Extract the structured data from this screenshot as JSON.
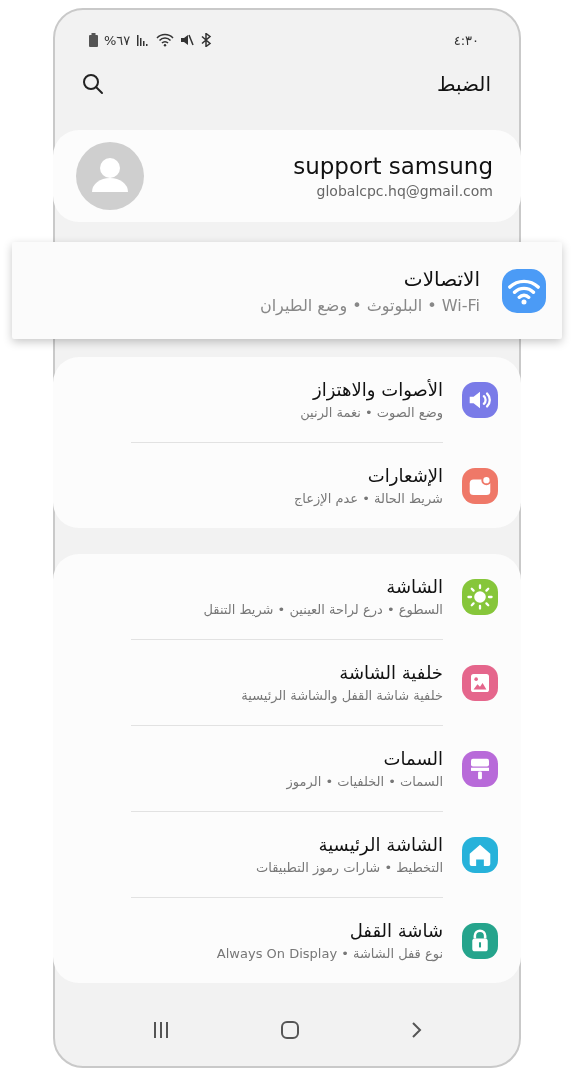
{
  "status_bar": {
    "time": "٤:٣٠",
    "battery": "%٦٧"
  },
  "header": {
    "title": "الضبط"
  },
  "profile": {
    "name": "support samsung",
    "email": "globalcpc.hq@gmail.com"
  },
  "groups": [
    {
      "highlighted": true,
      "items": [
        {
          "title": "الاتصالات",
          "subtitle": "Wi-Fi • البلوتوث • وضع الطيران",
          "color": "#4b9bf6"
        }
      ]
    },
    {
      "highlighted": false,
      "items": [
        {
          "title": "الأصوات والاهتزاز",
          "subtitle": "وضع الصوت • نغمة الرنين",
          "color": "#7a7be8"
        },
        {
          "title": "الإشعارات",
          "subtitle": "شريط الحالة • عدم الإزعاج",
          "color": "#ef7868"
        }
      ]
    },
    {
      "highlighted": false,
      "items": [
        {
          "title": "الشاشة",
          "subtitle": "السطوع • درع لراحة العينين • شريط التنقل",
          "color": "#86c63a"
        },
        {
          "title": "خلفية الشاشة",
          "subtitle": "خلفية شاشة القفل والشاشة الرئيسية",
          "color": "#e5668c"
        },
        {
          "title": "السمات",
          "subtitle": "السمات • الخلفيات • الرموز",
          "color": "#b86ad9"
        },
        {
          "title": "الشاشة الرئيسية",
          "subtitle": "التخطيط • شارات رموز التطبيقات",
          "color": "#27b2da"
        },
        {
          "title": "شاشة القفل",
          "subtitle": "نوع قفل الشاشة • Always On Display",
          "color": "#25a48c"
        }
      ]
    }
  ]
}
